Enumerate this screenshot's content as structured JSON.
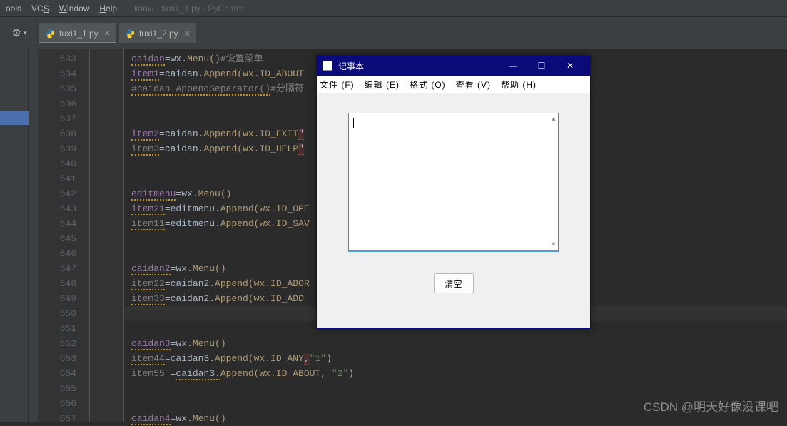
{
  "menubar": {
    "tools": "ools",
    "vcs_raw": "VCS",
    "window_raw": "Window",
    "help_raw": "Help",
    "title": "lianxi - fuxi1_1.py - PyCharm"
  },
  "tabs": [
    {
      "label": "fuxi1_1.py"
    },
    {
      "label": "fuxi1_2.py"
    }
  ],
  "gutter_lines": [
    "633",
    "634",
    "635",
    "636",
    "637",
    "638",
    "639",
    "640",
    "641",
    "642",
    "643",
    "644",
    "645",
    "646",
    "647",
    "648",
    "649",
    "650",
    "651",
    "652",
    "653",
    "654",
    "655",
    "656",
    "657"
  ],
  "code_lines": {
    "l633": {
      "a": "caidan",
      "b": "wx.",
      "c": "Menu()",
      "d": "#设置菜单"
    },
    "l634": {
      "a": "item1",
      "b": "caidan.",
      "c": "Append(wx.ID_ABOUT"
    },
    "l635": {
      "a": "#caidan.AppendSeparator()",
      "b": "#分隔符"
    },
    "l638": {
      "a": "item2",
      "b": "caidan.",
      "c": "Append(wx.ID_EXIT",
      "d": "\""
    },
    "l639": {
      "a": "item3",
      "b": "caidan.",
      "c": "Append(wx.ID_HELP",
      "d": "\""
    },
    "l642": {
      "a": "editmenu",
      "b": "wx.",
      "c": "Menu()"
    },
    "l643": {
      "a": "item21",
      "b": "editmenu.",
      "c": "Append(wx.ID_OPE"
    },
    "l644": {
      "a": "item11",
      "b": "editmenu.",
      "c": "Append(wx.ID_SAV"
    },
    "l647": {
      "a": "caidan2",
      "b": "wx.",
      "c": "Menu()"
    },
    "l648": {
      "a": "item22",
      "b": "caidan2.",
      "c": "Append(wx.ID_ABOR"
    },
    "l649": {
      "a": "item33",
      "b": "caidan2.",
      "c": "Append(wx.ID_ADD"
    },
    "l652": {
      "a": "caidan3",
      "b": "wx.",
      "c": "Menu()"
    },
    "l653": {
      "a": "item44",
      "b": "caidan3.",
      "c": "Append(wx.ID_ANY",
      "d": "\"1\"",
      "e": ")"
    },
    "l654": {
      "a": "item55 ",
      "b": "caidan3.",
      "c": "Append(wx.ID_ABOUT",
      "d": ", ",
      "e": "\"2\"",
      "f": ")"
    },
    "l657": {
      "a": "caidan4",
      "b": "wx.",
      "c": "Menu()"
    }
  },
  "notepad": {
    "title": "记事本",
    "menu": {
      "file": "文件 (F)",
      "edit": "编辑 (E)",
      "format": "格式 (O)",
      "view": "查看 (V)",
      "help": "帮助 (H)"
    },
    "clear_button": "清空"
  },
  "watermark": "CSDN @明天好像没课吧"
}
